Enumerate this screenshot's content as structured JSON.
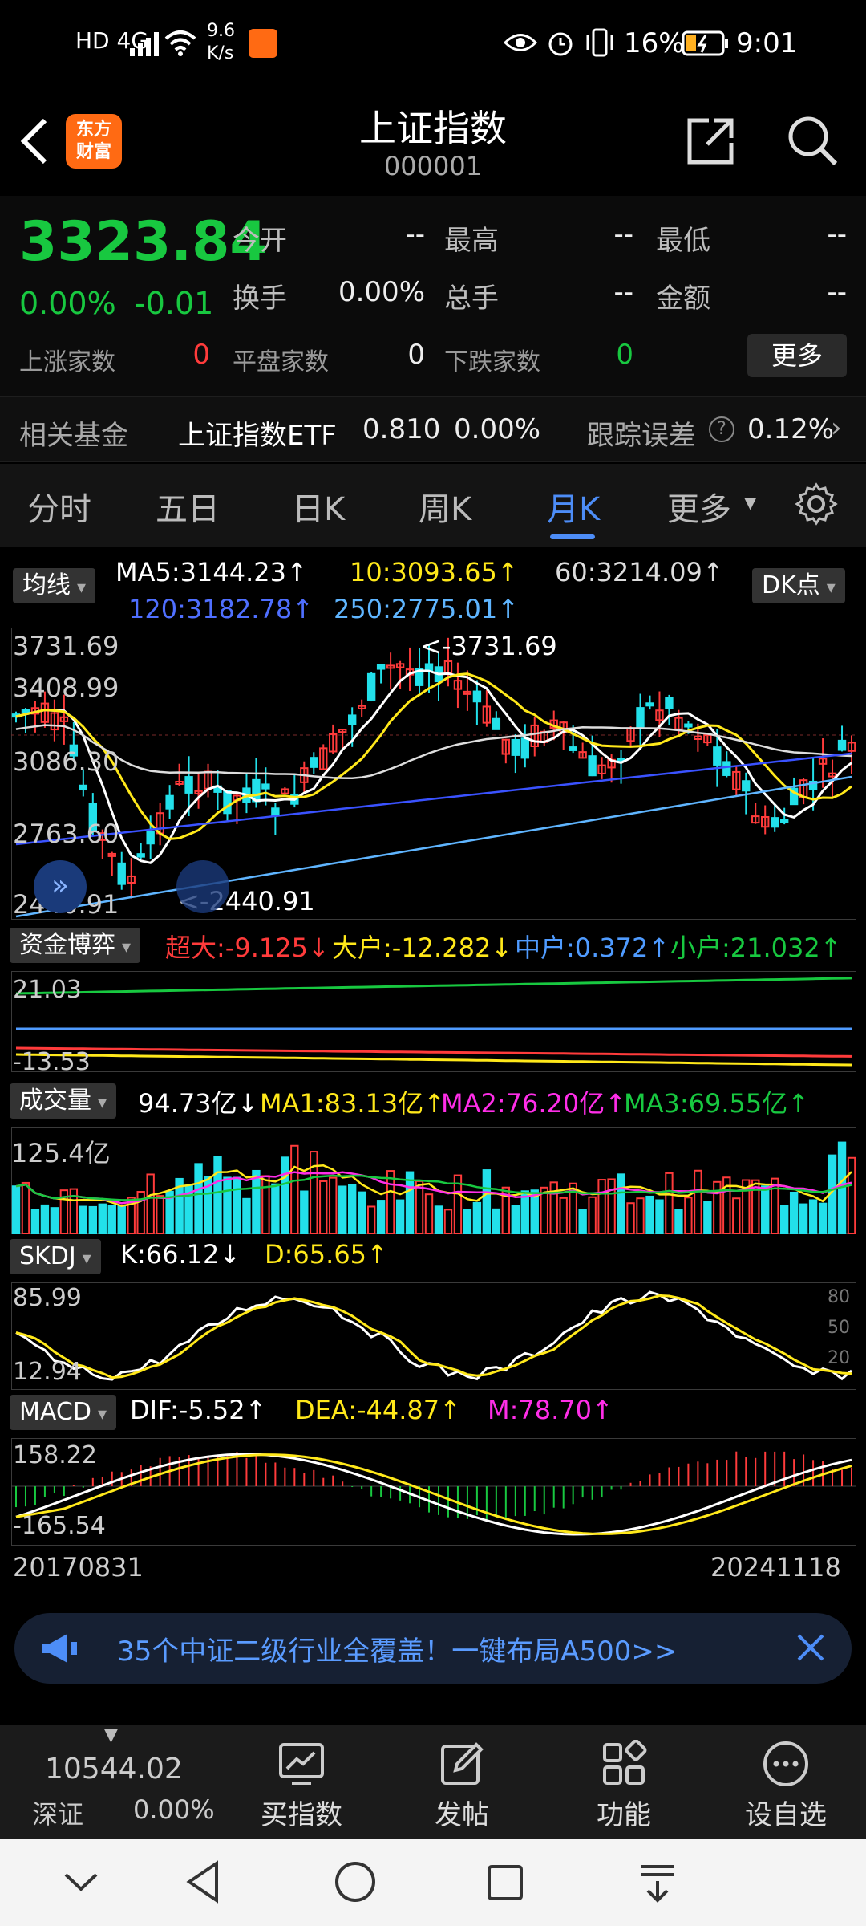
{
  "status_bar": {
    "left_icons": "HD 4G",
    "speed": "9.6",
    "speed_unit": "K/s",
    "battery": "16%",
    "time": "9:01"
  },
  "header": {
    "title": "上证指数",
    "code": "000001",
    "logo_line1": "东方",
    "logo_line2": "财富"
  },
  "quote": {
    "price": "3323.84",
    "change_pct": "0.00%",
    "change_abs": "-0.01",
    "open_label": "今开",
    "open_value": "--",
    "high_label": "最高",
    "high_value": "--",
    "low_label": "最低",
    "low_value": "--",
    "turnover_label": "换手",
    "turnover_value": "0.00%",
    "volume_label": "总手",
    "volume_value": "--",
    "amount_label": "金额",
    "amount_value": "--",
    "up_label": "上涨家数",
    "up_value": "0",
    "flat_label": "平盘家数",
    "flat_value": "0",
    "down_label": "下跌家数",
    "down_value": "0",
    "more_label": "更多"
  },
  "fund_bar": {
    "label": "相关基金",
    "fund_name": "上证指数ETF",
    "fund_price": "0.810",
    "fund_change": "0.00%",
    "tracking_label": "跟踪误差",
    "tracking_value": "0.12%"
  },
  "tabs": [
    "分时",
    "五日",
    "日K",
    "周K",
    "月K",
    "更多"
  ],
  "active_tab": "月K",
  "chart": {
    "ma_pill": "均线",
    "dk_pill": "DK点",
    "ma5": "MA5:3144.23↑",
    "ma10": "10:3093.65↑",
    "ma60": "60:3214.09↑",
    "ma120": "120:3182.78↑",
    "ma250": "250:2775.01↑",
    "price_ticks": [
      "3731.69",
      "3408.99",
      "3086.30",
      "2763.60",
      "2440.91"
    ],
    "high_marker": "<-3731.69",
    "low_marker": "<-2440.91",
    "fund_pill": "资金博弈",
    "fund_super": "超大:-9.125↓",
    "fund_large": "大户:-12.282↓",
    "fund_mid": "中户:0.372↑",
    "fund_small": "小户:21.032↑",
    "fund_ticks": [
      "21.03",
      "-13.53"
    ],
    "vol_pill": "成交量",
    "vol_cur": "94.73亿↓",
    "vol_ma1": "MA1:83.13亿↑",
    "vol_ma2": "MA2:76.20亿↑",
    "vol_ma3": "MA3:69.55亿↑",
    "vol_tick": "125.4亿",
    "skdj_pill": "SKDJ",
    "skdj_k": "K:66.12↓",
    "skdj_d": "D:65.65↑",
    "skdj_ticks": [
      "85.99",
      "12.94"
    ],
    "skdj_levels": [
      "80",
      "50",
      "20"
    ],
    "macd_pill": "MACD",
    "macd_dif": "DIF:-5.52↑",
    "macd_dea": "DEA:-44.87↑",
    "macd_m": "M:78.70↑",
    "macd_ticks": [
      "158.22",
      "-165.54"
    ],
    "date_start": "20170831",
    "date_end": "20241118"
  },
  "chart_data": {
    "type": "candlestick",
    "title": "上证指数 月K",
    "x_start": "20170831",
    "x_end": "20241118",
    "y_range": [
      2440.91,
      3731.69
    ],
    "high": 3731.69,
    "low": 2440.91,
    "ma": {
      "MA5": 3144.23,
      "MA10": 3093.65,
      "MA60": 3214.09,
      "MA120": 3182.78,
      "MA250": 2775.01
    }
  },
  "banner": {
    "text": "35个中证二级行业全覆盖！一键布局A500>>"
  },
  "bottom_nav": {
    "index_value": "10544.02",
    "index_name": "深证",
    "index_change": "0.00%",
    "buy_label": "买指数",
    "post_label": "发帖",
    "func_label": "功能",
    "fav_label": "设自选"
  },
  "colors": {
    "up": "#ff3b3b",
    "down": "#18c840",
    "accent": "#4d8df7",
    "cyan": "#22e0ea",
    "yellow": "#ffe81a",
    "magenta": "#ff2ee8"
  }
}
